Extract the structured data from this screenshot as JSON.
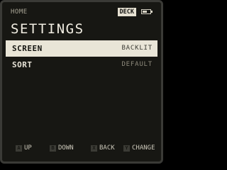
{
  "header": {
    "breadcrumb": "HOME",
    "badge": "DECK",
    "battery_level": 0.6
  },
  "title": "SETTINGS",
  "menu": [
    {
      "label": "SCREEN",
      "value": "BACKLIT",
      "selected": true
    },
    {
      "label": "SORT",
      "value": "DEFAULT",
      "selected": false
    }
  ],
  "footer": [
    {
      "key": "A",
      "action": "UP"
    },
    {
      "key": "B",
      "action": "DOWN"
    },
    {
      "key": "X",
      "action": "BACK"
    },
    {
      "key": "Y",
      "action": "CHANGE"
    }
  ],
  "colors": {
    "background": "#171713",
    "highlight": "#e9e5d7",
    "text": "#e8e4d8"
  }
}
